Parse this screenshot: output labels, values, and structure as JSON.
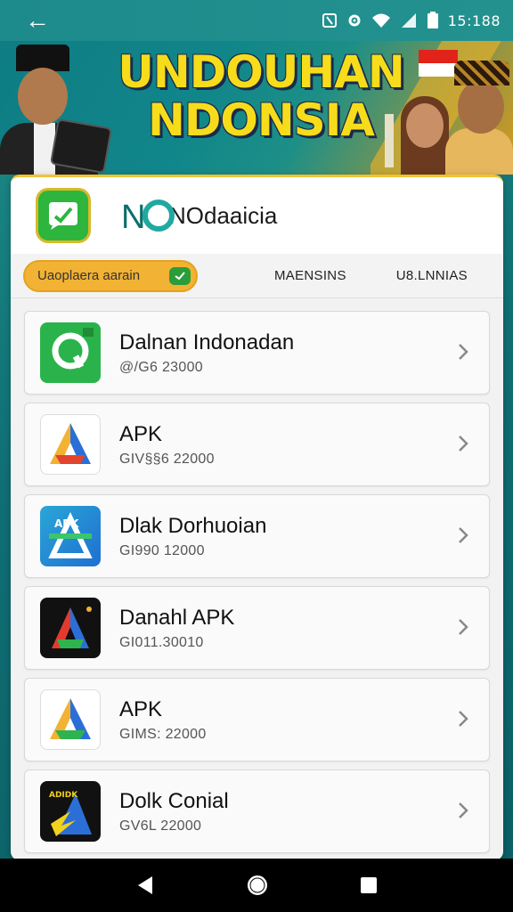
{
  "status": {
    "time": "15:188"
  },
  "banner": {
    "title_line1": "UNDOUHAN",
    "title_line2": "NDONSIA"
  },
  "app": {
    "brand_name": "NOdaaicia"
  },
  "tabs": [
    {
      "label": "Uaoplaera aarain"
    },
    {
      "label": "MAENSINS"
    },
    {
      "label": "U8.LNNIAS"
    }
  ],
  "items": [
    {
      "title": "Dalnan Indonadan",
      "subtitle": "@/G6 23000",
      "icon": "green-chat-a-icon"
    },
    {
      "title": "APK",
      "subtitle": "GIV§§6 22000",
      "icon": "triangle-a-icon"
    },
    {
      "title": "Dlak Dorhuoian",
      "subtitle": "GI990 12000",
      "icon": "apk-tile-icon"
    },
    {
      "title": "Danahl APK",
      "subtitle": "GI011.30010",
      "icon": "dark-a-icon"
    },
    {
      "title": "APK",
      "subtitle": "GIMS: 22000",
      "icon": "triangle-a-icon"
    },
    {
      "title": "Dolk Conial",
      "subtitle": "GV6L 22000",
      "icon": "dark-tile-icon"
    }
  ],
  "colors": {
    "accent": "#f2b233",
    "teal": "#1d8a8c",
    "green": "#2db53e"
  }
}
